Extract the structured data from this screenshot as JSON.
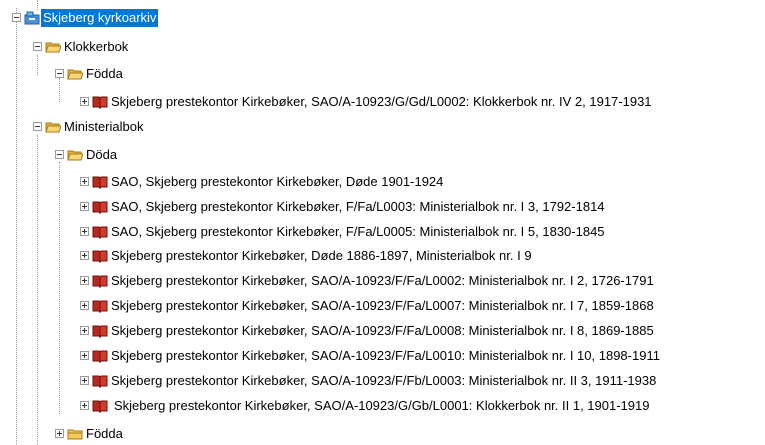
{
  "tree": {
    "root": {
      "label": "Skjeberg kyrkoarkiv",
      "icon": "archive-icon",
      "expanded": true,
      "selected": true
    },
    "nodes": [
      {
        "label": "Klokkerbok",
        "icon": "folder-open-icon",
        "expanded": true
      },
      {
        "label": "Födda",
        "icon": "folder-open-icon",
        "expanded": true
      },
      {
        "label": "Skjeberg prestekontor Kirkebøker, SAO/A-10923/G/Gd/L0002: Klokkerbok nr. IV 2, 1917-1931",
        "icon": "book-icon",
        "expanded": false
      },
      {
        "label": "Ministerialbok",
        "icon": "folder-open-icon",
        "expanded": true
      },
      {
        "label": "Döda",
        "icon": "folder-open-icon",
        "expanded": true
      },
      {
        "label": "SAO, Skjeberg prestekontor Kirkebøker, Døde 1901-1924",
        "icon": "book-icon",
        "expanded": false
      },
      {
        "label": "SAO, Skjeberg prestekontor Kirkebøker, F/Fa/L0003: Ministerialbok nr. I 3, 1792-1814",
        "icon": "book-icon",
        "expanded": false
      },
      {
        "label": "SAO, Skjeberg prestekontor Kirkebøker, F/Fa/L0005: Ministerialbok nr. I 5, 1830-1845",
        "icon": "book-icon",
        "expanded": false
      },
      {
        "label": "Skjeberg prestekontor Kirkebøker, Døde 1886-1897, Ministerialbok nr. I 9",
        "icon": "book-icon",
        "expanded": false
      },
      {
        "label": "Skjeberg prestekontor Kirkebøker, SAO/A-10923/F/Fa/L0002: Ministerialbok nr. I 2, 1726-1791",
        "icon": "book-icon",
        "expanded": false
      },
      {
        "label": "Skjeberg prestekontor Kirkebøker, SAO/A-10923/F/Fa/L0007: Ministerialbok nr. I 7, 1859-1868",
        "icon": "book-icon",
        "expanded": false
      },
      {
        "label": "Skjeberg prestekontor Kirkebøker, SAO/A-10923/F/Fa/L0008: Ministerialbok nr. I 8, 1869-1885",
        "icon": "book-icon",
        "expanded": false
      },
      {
        "label": "Skjeberg prestekontor Kirkebøker, SAO/A-10923/F/Fa/L0010: Ministerialbok nr. I 10, 1898-1911",
        "icon": "book-icon",
        "expanded": false
      },
      {
        "label": "Skjeberg prestekontor Kirkebøker, SAO/A-10923/F/Fb/L0003: Ministerialbok nr. II 3, 1911-1938",
        "icon": "book-icon",
        "expanded": false
      },
      {
        "label": "Skjeberg prestekontor Kirkebøker, SAO/A-10923/G/Gb/L0001: Klokkerbok nr. II 1, 1901-1919",
        "icon": "book-icon",
        "expanded": false
      },
      {
        "label": "Födda",
        "icon": "folder-closed-icon",
        "expanded": false
      }
    ]
  },
  "colors": {
    "selection": "#0078d7",
    "folder": "#f1c75a",
    "book": "#c0392b"
  }
}
